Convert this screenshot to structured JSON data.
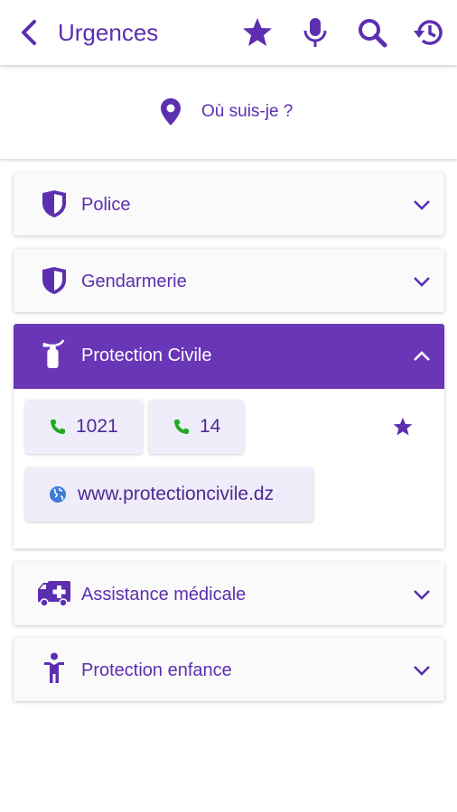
{
  "appbar": {
    "title": "Urgences"
  },
  "location": {
    "label": "Où suis-je ?"
  },
  "sections": {
    "police": {
      "label": "Police"
    },
    "gendarmerie": {
      "label": "Gendarmerie"
    },
    "protection_civile": {
      "label": "Protection Civile",
      "phones": [
        "1021",
        "14"
      ],
      "website": "www.protectioncivile.dz"
    },
    "assistance": {
      "label": "Assistance médicale"
    },
    "enfance": {
      "label": "Protection enfance"
    }
  },
  "colors": {
    "primary": "#6a36b8",
    "phone_icon": "#22aa22",
    "chip_bg": "#efedf9"
  }
}
